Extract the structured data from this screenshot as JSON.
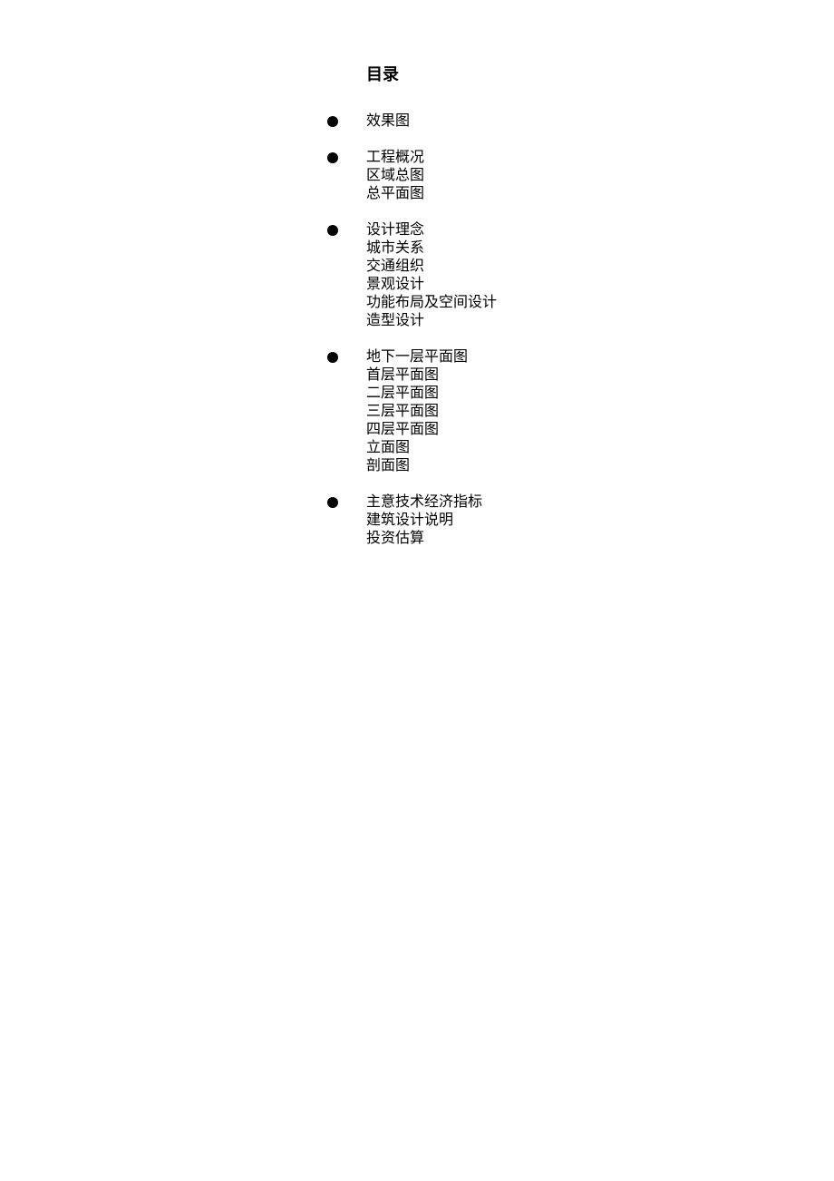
{
  "title": "目录",
  "sections": [
    {
      "items": [
        "效果图"
      ]
    },
    {
      "items": [
        "工程概况",
        "区域总图",
        "总平面图"
      ]
    },
    {
      "items": [
        "设计理念",
        "城市关系",
        "交通组织",
        "景观设计",
        "功能布局及空间设计",
        "造型设计"
      ]
    },
    {
      "items": [
        "地下一层平面图",
        "首层平面图",
        "二层平面图",
        "三层平面图",
        "四层平面图",
        "立面图",
        "剖面图"
      ]
    },
    {
      "items": [
        "主意技术经济指标",
        "建筑设计说明",
        "投资估算"
      ]
    }
  ]
}
